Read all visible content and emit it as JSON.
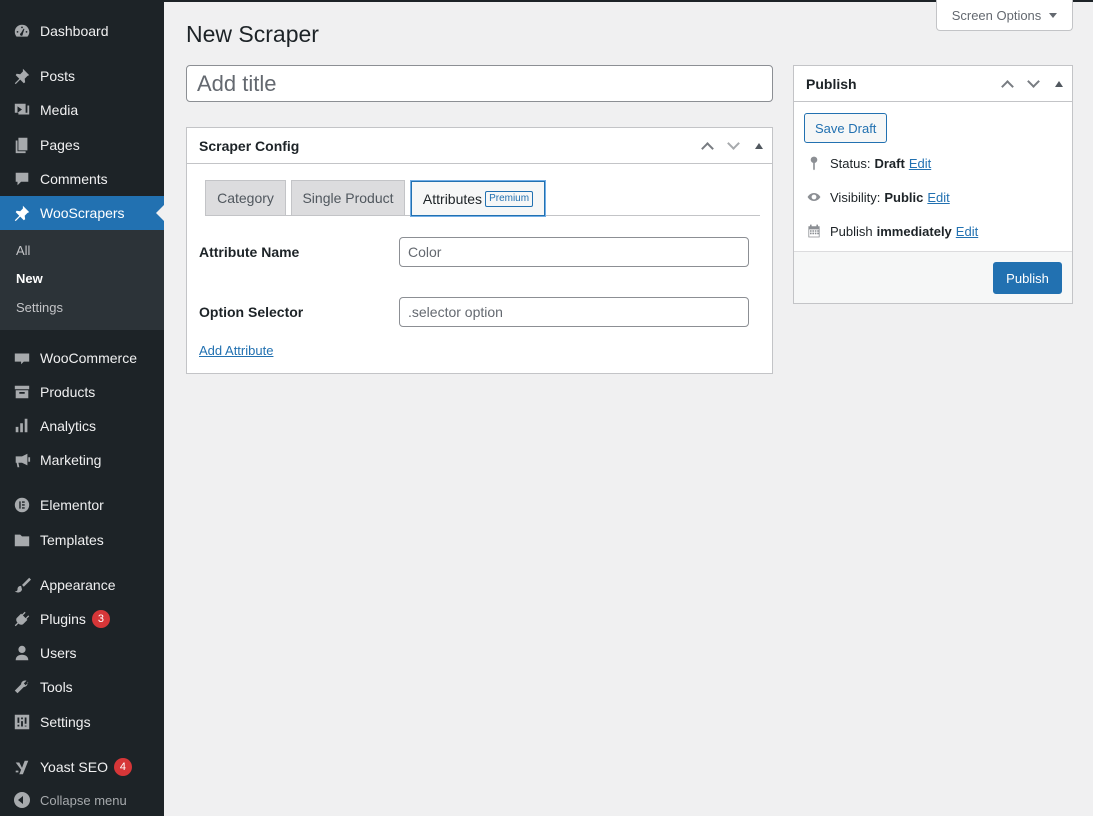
{
  "sidebar": {
    "items": [
      {
        "label": "Dashboard",
        "icon": "dashboard-icon"
      },
      {
        "label": "Posts",
        "icon": "pin-icon"
      },
      {
        "label": "Media",
        "icon": "media-icon"
      },
      {
        "label": "Pages",
        "icon": "pages-icon"
      },
      {
        "label": "Comments",
        "icon": "comment-icon"
      },
      {
        "label": "WooScrapers",
        "icon": "pin-icon"
      },
      {
        "label": "WooCommerce",
        "icon": "woo-icon"
      },
      {
        "label": "Products",
        "icon": "archive-icon"
      },
      {
        "label": "Analytics",
        "icon": "bar-chart-icon"
      },
      {
        "label": "Marketing",
        "icon": "megaphone-icon"
      },
      {
        "label": "Elementor",
        "icon": "elementor-icon"
      },
      {
        "label": "Templates",
        "icon": "folder-icon"
      },
      {
        "label": "Appearance",
        "icon": "brush-icon"
      },
      {
        "label": "Plugins",
        "icon": "plug-icon",
        "badge": "3"
      },
      {
        "label": "Users",
        "icon": "user-icon"
      },
      {
        "label": "Tools",
        "icon": "wrench-icon"
      },
      {
        "label": "Settings",
        "icon": "sliders-icon"
      },
      {
        "label": "Yoast SEO",
        "icon": "yoast-icon",
        "badge": "4"
      }
    ],
    "submenu": [
      "All",
      "New",
      "Settings"
    ],
    "collapse_label": "Collapse menu"
  },
  "header": {
    "screen_options": "Screen Options",
    "page_title": "New Scraper"
  },
  "title_field": {
    "placeholder": "Add title"
  },
  "scraper_config": {
    "title": "Scraper Config",
    "tabs": [
      "Category",
      "Single Product",
      "Attributes"
    ],
    "premium_badge": "Premium",
    "attribute_name_label": "Attribute Name",
    "attribute_name_placeholder": "Color",
    "option_selector_label": "Option Selector",
    "option_selector_placeholder": ".selector option",
    "add_attribute": "Add Attribute"
  },
  "publish": {
    "title": "Publish",
    "save_draft": "Save Draft",
    "status_label": "Status:",
    "status_value": "Draft",
    "visibility_label": "Visibility:",
    "visibility_value": "Public",
    "publish_label": "Publish",
    "publish_value": "immediately",
    "edit": "Edit",
    "publish_button": "Publish"
  },
  "colors": {
    "accent": "#2271b1",
    "sidebar": "#1d2327",
    "badge": "#d63638"
  }
}
